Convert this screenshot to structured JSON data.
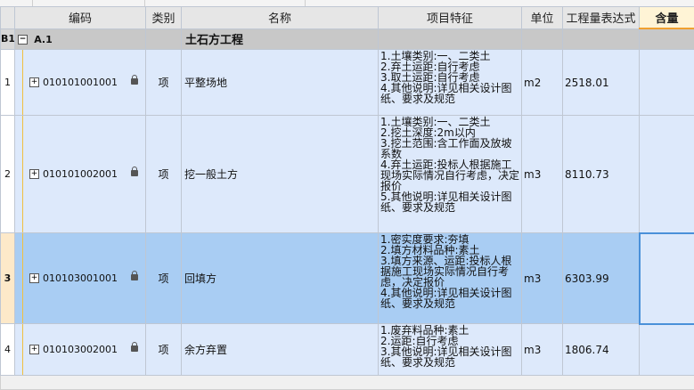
{
  "columns": {
    "code": "编码",
    "type": "类别",
    "name": "名称",
    "features": "项目特征",
    "unit": "单位",
    "expr": "工程量表达式",
    "content": "含量"
  },
  "group": {
    "row_label": "B1",
    "toggle": "−",
    "code": "A.1",
    "name": "土石方工程"
  },
  "rows": [
    {
      "num": "1",
      "code": "010101001001",
      "type": "项",
      "name": "平整场地",
      "features": [
        "1.土壤类别:一、二类土",
        "2.弃土运距:自行考虑",
        "3.取土运距:自行考虑",
        "4.其他说明:详见相关设计图纸、要求及规范"
      ],
      "unit": "m2",
      "expr": "2518.01"
    },
    {
      "num": "2",
      "code": "010101002001",
      "type": "项",
      "name": "挖一般土方",
      "features": [
        "1.土壤类别:一、二类土",
        "2.挖土深度:2m以内",
        "3.挖土范围:含工作面及放坡系数",
        "4.弃土运距:投标人根据施工现场实际情况自行考虑，决定报价",
        "5.其他说明:详见相关设计图纸、要求及规范"
      ],
      "unit": "m3",
      "expr": "8110.73"
    },
    {
      "num": "3",
      "code": "010103001001",
      "type": "项",
      "name": "回填方",
      "features": [
        "1.密实度要求:夯填",
        "2.填方材料品种:素土",
        "3.填方来源、运距:投标人根据施工现场实际情况自行考虑，决定报价",
        "4.其他说明:详见相关设计图纸、要求及规范"
      ],
      "unit": "m3",
      "expr": "6303.99"
    },
    {
      "num": "4",
      "code": "010103002001",
      "type": "项",
      "name": "余方弃置",
      "features": [
        "1.废弃料品种:素土",
        "2.运距:自行考虑",
        "3.其他说明:详见相关设计图纸、要求及规范"
      ],
      "unit": "m3",
      "expr": "1806.74"
    }
  ],
  "icons": {
    "expand": "plus-box-icon",
    "collapse": "minus-box-icon",
    "lock": "lock-icon"
  },
  "colors": {
    "row_bg": "#dde9fb",
    "selected_bg": "#a9cdf3",
    "group_bg": "#c8c8c8",
    "accent": "#4a90d9"
  }
}
